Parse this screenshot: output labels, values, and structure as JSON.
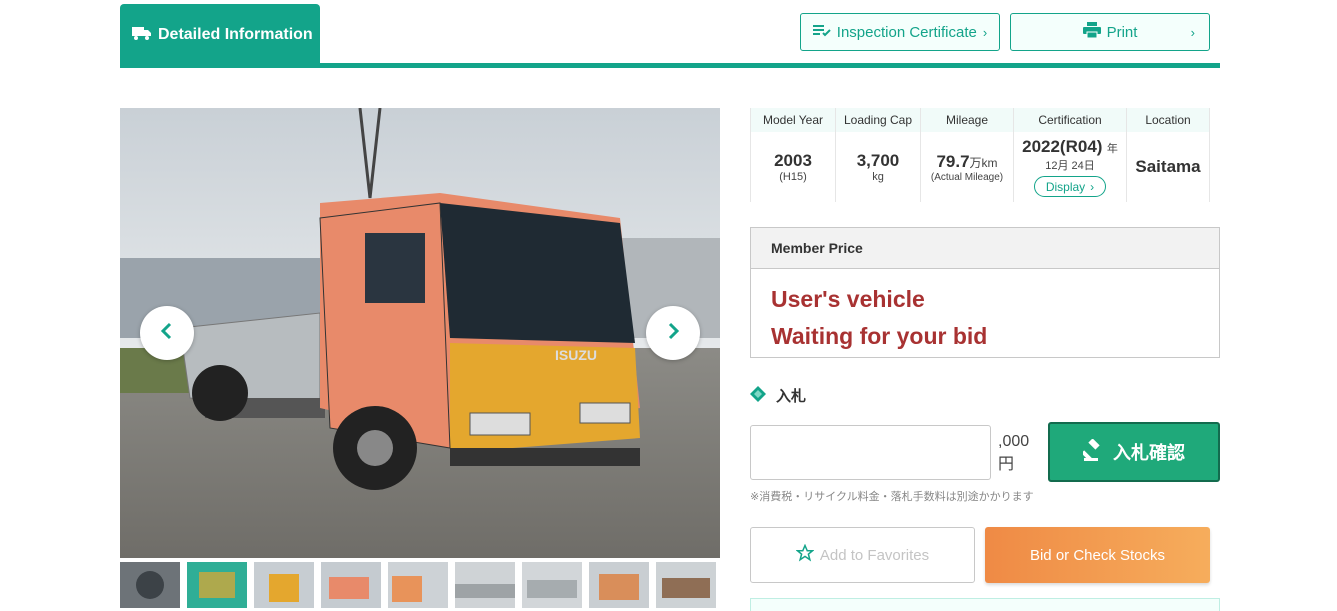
{
  "header": {
    "active_tab": "Detailed Information",
    "inspection_button": "Inspection Certificate",
    "print_button": "Print"
  },
  "specs": {
    "model_year": {
      "label": "Model Year",
      "value": "2003",
      "sub": "(H15)"
    },
    "loading_cap": {
      "label": "Loading Cap",
      "value": "3,700",
      "sub": "kg"
    },
    "mileage": {
      "label": "Mileage",
      "value": "79.7",
      "unit": "万km",
      "sub": "(Actual Mileage)"
    },
    "certification": {
      "label": "Certification",
      "value": "2022(R04)",
      "year_suffix": "年",
      "date": "12月 24日",
      "display_button": "Display"
    },
    "location": {
      "label": "Location",
      "value": "Saitama"
    }
  },
  "member_price": {
    "title": "Member Price",
    "line1": "User's vehicle",
    "line2": "Waiting for your bid"
  },
  "bid": {
    "label": "入札",
    "input_value": "",
    "unit_line1": ",000",
    "unit_line2": "円",
    "submit_label": "入札確認",
    "notice": "※消費税・リサイクル料金・落札手数料は別途かかります"
  },
  "actions": {
    "favorites": "Add to Favorites",
    "stocks": "Bid or Check Stocks"
  },
  "colors": {
    "accent": "#13a48a",
    "price_text": "#a83232",
    "bid_button": "#1fa97a",
    "stock_button": "#ef8a45"
  },
  "gallery": {
    "thumbnail_count": 9,
    "active_index": 1
  }
}
